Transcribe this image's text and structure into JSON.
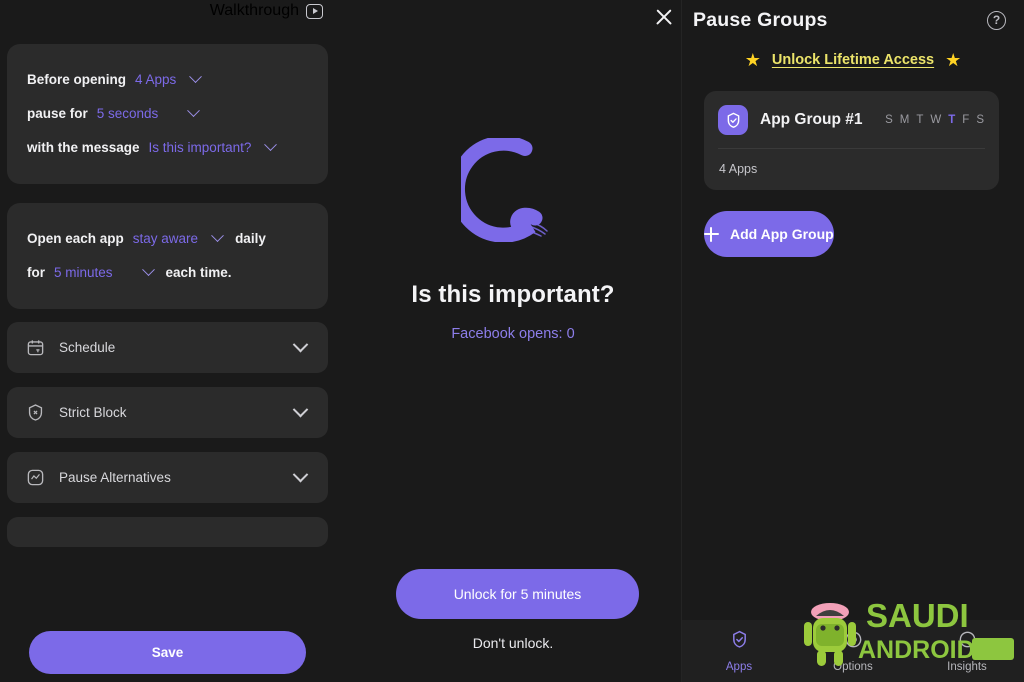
{
  "colors": {
    "accent": "#7c6ae8",
    "page_bg": "#1a1a1a",
    "card_bg": "#2b2b2b",
    "gold": "#ece46a",
    "star": "#ffd324"
  },
  "left_panel": {
    "walkthrough_label": "Walkthrough",
    "walkthrough_icon": "play-icon",
    "config_rows": [
      {
        "static_before": "Before opening",
        "value": "4 Apps",
        "static_after": "",
        "chevron": "chevron-down-icon"
      },
      {
        "static_before": "pause for",
        "value": "5 seconds",
        "static_after": "",
        "chevron": "chevron-down-icon"
      },
      {
        "static_before": "with the message",
        "value": "Is this important?",
        "static_after": "",
        "chevron": "chevron-down-icon"
      }
    ],
    "usage_rows": [
      {
        "static_before": "Open each app",
        "value": "stay aware",
        "static_after": "daily",
        "chevron": "chevron-down-icon"
      },
      {
        "static_before": "for",
        "value": "5 minutes",
        "static_after": "each time.",
        "chevron": "chevron-down-icon"
      }
    ],
    "collapse_rows": [
      {
        "label": "Schedule",
        "icon": "calendar-icon"
      },
      {
        "label": "Strict Block",
        "icon": "shield-x-icon"
      },
      {
        "label": "Pause Alternatives",
        "icon": "pulse-square-icon"
      }
    ],
    "save_label": "Save"
  },
  "center_panel": {
    "close_icon": "close-icon",
    "logo_icon": "enso-circle-logo",
    "title": "Is this important?",
    "subtitle": "Facebook opens: 0",
    "unlock_button": "Unlock for 5 minutes",
    "dont_unlock": "Don't unlock."
  },
  "right_panel": {
    "title": "Pause Groups",
    "help_icon": "question-mark-icon",
    "help_glyph": "?",
    "lifetime_link": "Unlock Lifetime Access",
    "star_glyph": "★",
    "group": {
      "icon": "shield-check-icon",
      "name": "App Group #1",
      "days": [
        {
          "letter": "S",
          "active": false
        },
        {
          "letter": "M",
          "active": false
        },
        {
          "letter": "T",
          "active": false
        },
        {
          "letter": "W",
          "active": false
        },
        {
          "letter": "T",
          "active": true
        },
        {
          "letter": "F",
          "active": false
        },
        {
          "letter": "S",
          "active": false
        }
      ],
      "apps_count": "4 Apps"
    },
    "add_group_label": "Add App Group",
    "nav": [
      {
        "label": "Apps",
        "icon": "shield-check-icon",
        "active": true
      },
      {
        "label": "Options",
        "icon": "gear-icon",
        "active": false
      },
      {
        "label": "Insights",
        "icon": "chart-icon",
        "active": false
      }
    ]
  },
  "watermark": {
    "line1": "SAUDI",
    "line2": "ANDROID"
  }
}
